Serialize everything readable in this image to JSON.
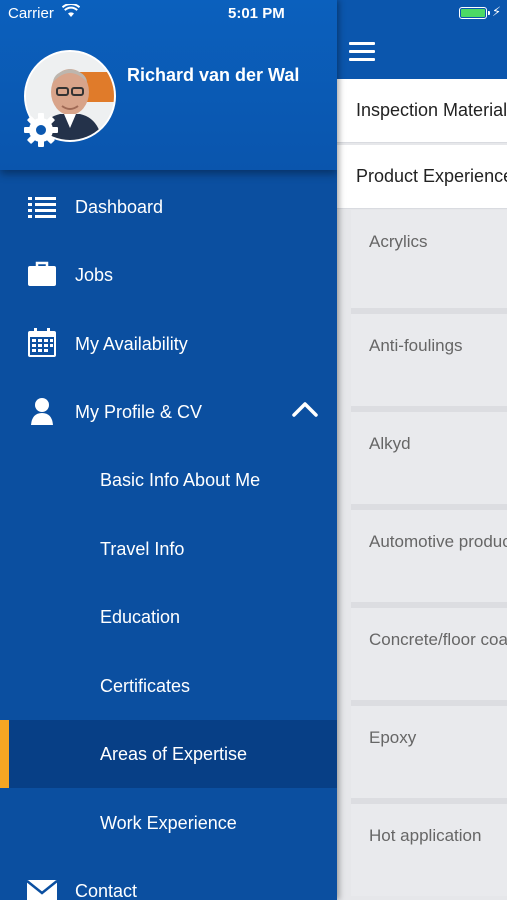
{
  "status_bar": {
    "carrier": "Carrier",
    "time": "5:01 PM"
  },
  "user": {
    "name": "Richard van der Wal"
  },
  "menu": {
    "items": [
      {
        "label": "Dashboard",
        "icon": "list-icon"
      },
      {
        "label": "Jobs",
        "icon": "briefcase-icon"
      },
      {
        "label": "My Availability",
        "icon": "calendar-icon"
      },
      {
        "label": "My Profile & CV",
        "icon": "person-icon",
        "expanded": true
      },
      {
        "label": "Contact",
        "icon": "envelope-icon"
      }
    ],
    "submenu": [
      {
        "label": "Basic Info About Me"
      },
      {
        "label": "Travel Info"
      },
      {
        "label": "Education"
      },
      {
        "label": "Certificates"
      },
      {
        "label": "Areas of Expertise",
        "active": true
      },
      {
        "label": "Work Experience"
      }
    ]
  },
  "content": {
    "tabs": [
      {
        "label": "Inspection Materials"
      },
      {
        "label": "Product Experience"
      }
    ],
    "experience_items": [
      {
        "label": "Acrylics"
      },
      {
        "label": "Anti-foulings"
      },
      {
        "label": "Alkyd"
      },
      {
        "label": "Automotive produc"
      },
      {
        "label": "Concrete/floor coa"
      },
      {
        "label": "Epoxy"
      },
      {
        "label": "Hot application"
      }
    ]
  },
  "colors": {
    "drawer_bg": "#0b4fa0",
    "active_item_bg": "#073f86",
    "active_indicator": "#f6a623",
    "battery": "#4cd964"
  }
}
